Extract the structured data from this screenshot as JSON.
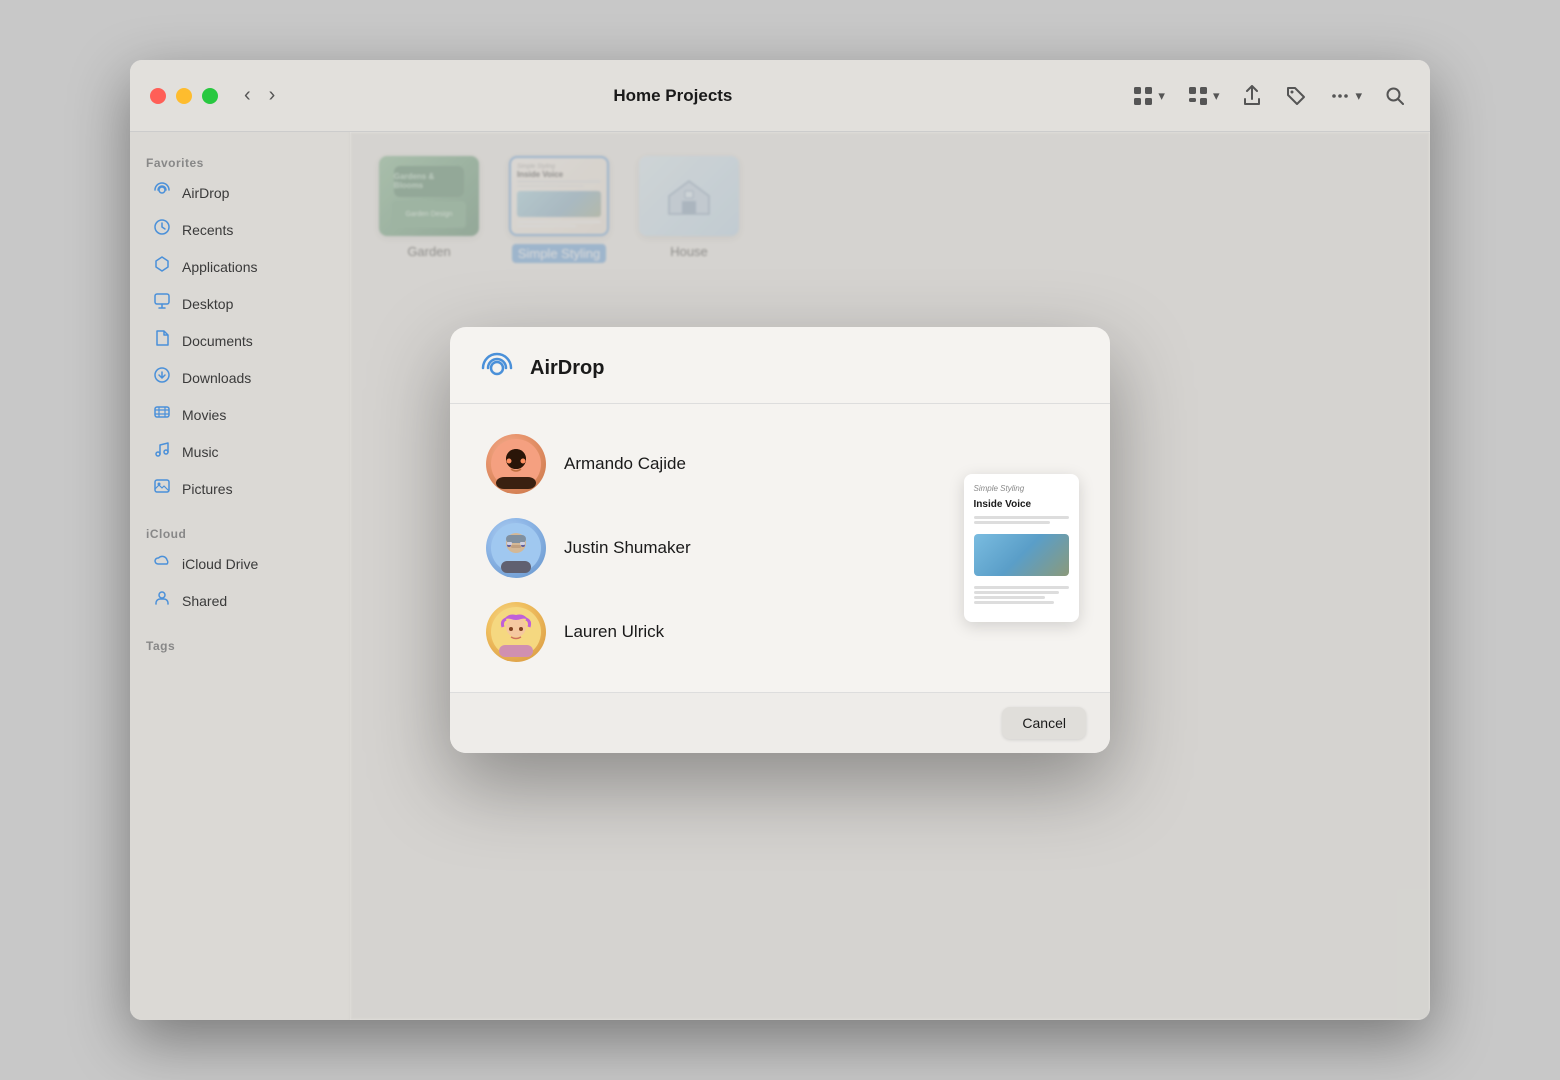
{
  "window": {
    "title": "Home Projects"
  },
  "toolbar": {
    "back_label": "‹",
    "forward_label": "›",
    "view_grid_label": "⊞",
    "share_label": "⬆",
    "tag_label": "◇",
    "more_label": "•••",
    "search_label": "⌕"
  },
  "sidebar": {
    "favorites_label": "Favorites",
    "icloud_label": "iCloud",
    "tags_label": "Tags",
    "items": [
      {
        "id": "airdrop",
        "label": "AirDrop",
        "icon": "📡"
      },
      {
        "id": "recents",
        "label": "Recents",
        "icon": "🕐"
      },
      {
        "id": "applications",
        "label": "Applications",
        "icon": "🚀"
      },
      {
        "id": "desktop",
        "label": "Desktop",
        "icon": "🖥"
      },
      {
        "id": "documents",
        "label": "Documents",
        "icon": "📄"
      },
      {
        "id": "downloads",
        "label": "Downloads",
        "icon": "⬇"
      },
      {
        "id": "movies",
        "label": "Movies",
        "icon": "🎬"
      },
      {
        "id": "music",
        "label": "Music",
        "icon": "🎵"
      },
      {
        "id": "pictures",
        "label": "Pictures",
        "icon": "🖼"
      }
    ],
    "icloud_items": [
      {
        "id": "icloud-drive",
        "label": "iCloud Drive",
        "icon": "☁"
      },
      {
        "id": "shared",
        "label": "Shared",
        "icon": "📁"
      }
    ]
  },
  "files": [
    {
      "id": "garden",
      "name": "Garden",
      "type": "garden"
    },
    {
      "id": "simple-styling",
      "name": "Simple Styling",
      "type": "styling",
      "selected": true
    },
    {
      "id": "house",
      "name": "House",
      "type": "house"
    }
  ],
  "airdrop_modal": {
    "title": "AirDrop",
    "people": [
      {
        "id": "armando",
        "name": "Armando Cajide",
        "avatar_type": "armando",
        "emoji": "👨"
      },
      {
        "id": "justin",
        "name": "Justin Shumaker",
        "avatar_type": "justin",
        "emoji": "🧑"
      },
      {
        "id": "lauren",
        "name": "Lauren Ulrick",
        "avatar_type": "lauren",
        "emoji": "👩"
      }
    ],
    "doc_preview": {
      "subtitle": "Simple Styling",
      "heading": "Inside Voice",
      "body_lines": 3
    },
    "cancel_label": "Cancel"
  }
}
